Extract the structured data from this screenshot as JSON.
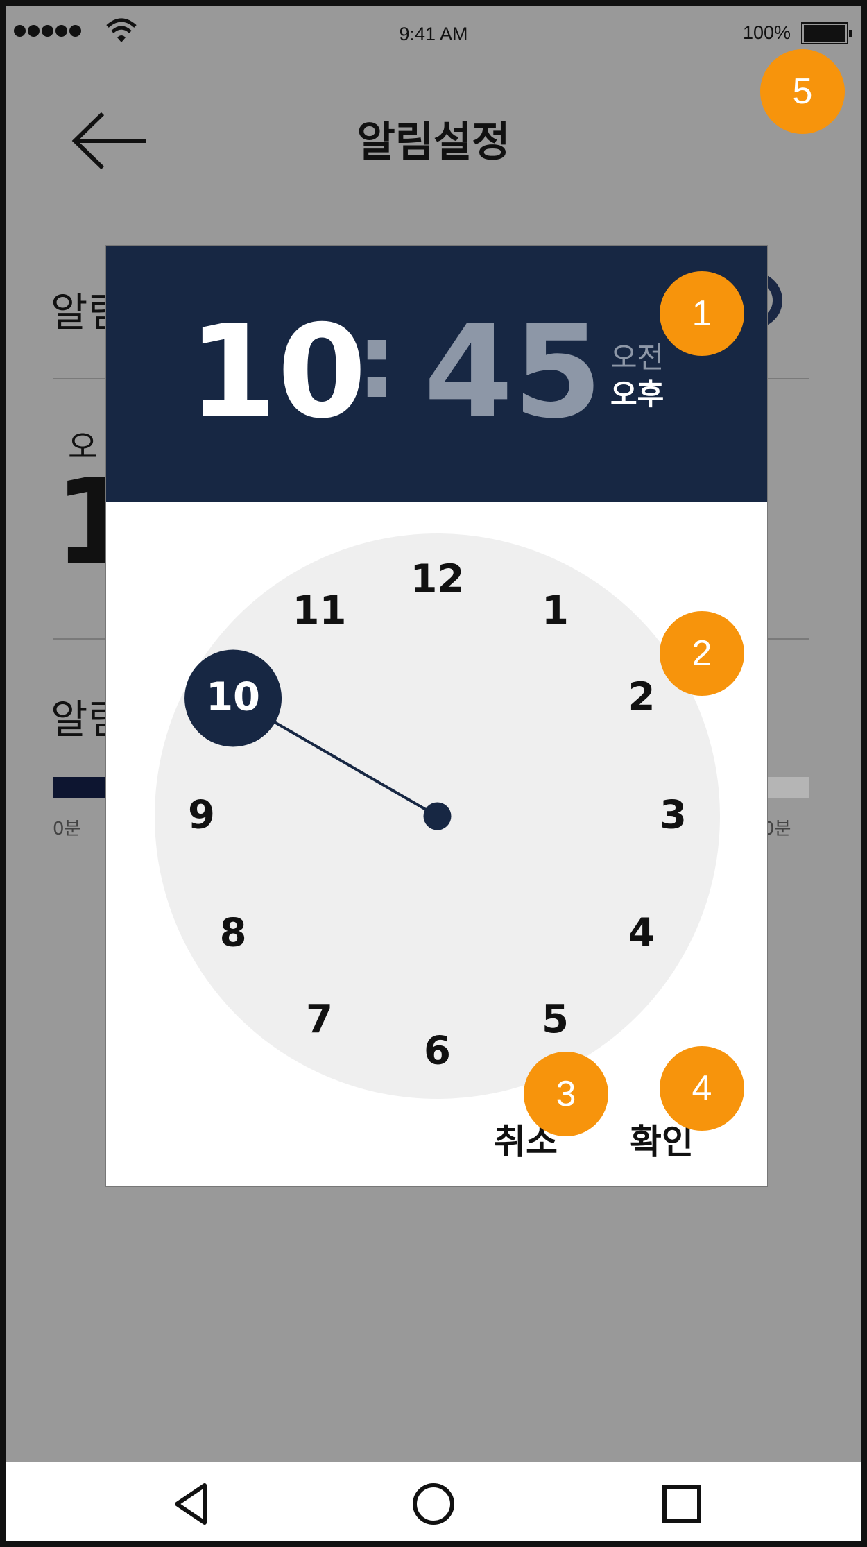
{
  "status_bar": {
    "time": "9:41 AM",
    "battery": "100%"
  },
  "header": {
    "title": "알림설정"
  },
  "background": {
    "label1": "알림",
    "ampm": "오",
    "big_time": "1",
    "label2": "알림",
    "min_left": "0분",
    "min_right": "0분"
  },
  "dialog": {
    "hour": "10",
    "separator": ":",
    "minute": "45",
    "am_label": "오전",
    "pm_label": "오후",
    "selected_period": "오후",
    "selected_hour": "10",
    "clock_numbers": [
      "12",
      "1",
      "2",
      "3",
      "4",
      "5",
      "6",
      "7",
      "8",
      "9",
      "10",
      "11"
    ],
    "cancel_label": "취소",
    "ok_label": "확인"
  },
  "markers": [
    "1",
    "2",
    "3",
    "4",
    "5"
  ],
  "colors": {
    "header_bg": "#172743",
    "accent": "#172743",
    "dim_text": "#8d97a7",
    "overlay": "#999999",
    "clock_face": "#efefef",
    "marker": "#f7940c"
  },
  "nav_icons": [
    "back-triangle-icon",
    "home-circle-icon",
    "recent-square-icon"
  ]
}
